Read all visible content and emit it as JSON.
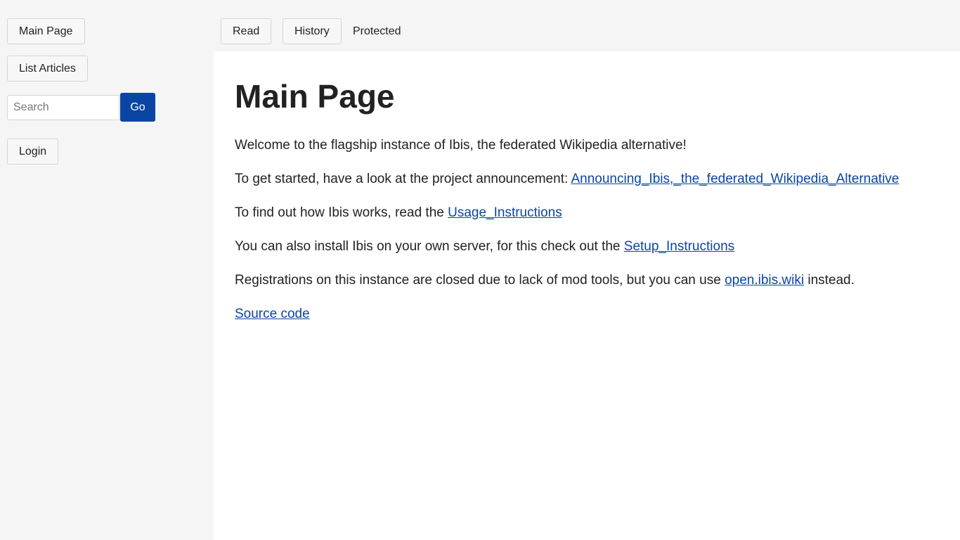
{
  "sidebar": {
    "main_page_label": "Main Page",
    "list_articles_label": "List Articles",
    "search": {
      "placeholder": "Search",
      "value": "",
      "go_label": "Go"
    },
    "login_label": "Login"
  },
  "tabs": {
    "read_label": "Read",
    "history_label": "History",
    "protected_label": "Protected"
  },
  "article": {
    "title": "Main Page",
    "p1": "Welcome to the flagship instance of Ibis, the federated Wikipedia alternative!",
    "p2_text": "To get started, have a look at the project announcement: ",
    "p2_link": "Announcing_Ibis,_the_federated_Wikipedia_Alternative",
    "p3_text": "To find out how Ibis works, read the ",
    "p3_link": "Usage_Instructions",
    "p4_text": "You can also install Ibis on your own server, for this check out the ",
    "p4_link": "Setup_Instructions",
    "p5_text": "Registrations on this instance are closed due to lack of mod tools, but you can use ",
    "p5_link": "open.ibis.wiki",
    "p5_after": " instead.",
    "source_link": "Source code"
  },
  "colors": {
    "accent": "#0b45a3",
    "sidebar_bg": "#f5f5f5",
    "content_bg": "#ffffff"
  }
}
